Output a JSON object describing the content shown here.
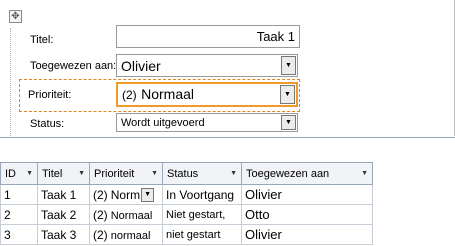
{
  "form": {
    "move_handle_glyph": "✥",
    "title": {
      "label": "Titel:",
      "value": "Taak 1"
    },
    "assigned": {
      "label": "Toegewezen aan:",
      "value": "Olivier"
    },
    "priority": {
      "label": "Prioriteit:",
      "value_num": "(2)",
      "value_text": "Normaal"
    },
    "status": {
      "label": "Status:",
      "value": "Wordt uitgevoerd"
    }
  },
  "grid": {
    "columns": [
      "ID",
      "Titel",
      "Prioriteit",
      "Status",
      "Toegewezen aan"
    ],
    "rows": [
      {
        "id": "1",
        "title": "Taak 1",
        "priority_num": "(2)",
        "priority_text": "Norm",
        "status": "In Voortgang",
        "assigned": "Olivier"
      },
      {
        "id": "2",
        "title": "Taak 2",
        "priority_num": "(2)",
        "priority_text": "Normaal",
        "status": "Niet gestart,",
        "assigned": "Otto"
      },
      {
        "id": "3",
        "title": "Taak 3",
        "priority_num": "(2)",
        "priority_text": "normaal",
        "status": "niet gestart",
        "assigned": "Olivier"
      }
    ]
  }
}
